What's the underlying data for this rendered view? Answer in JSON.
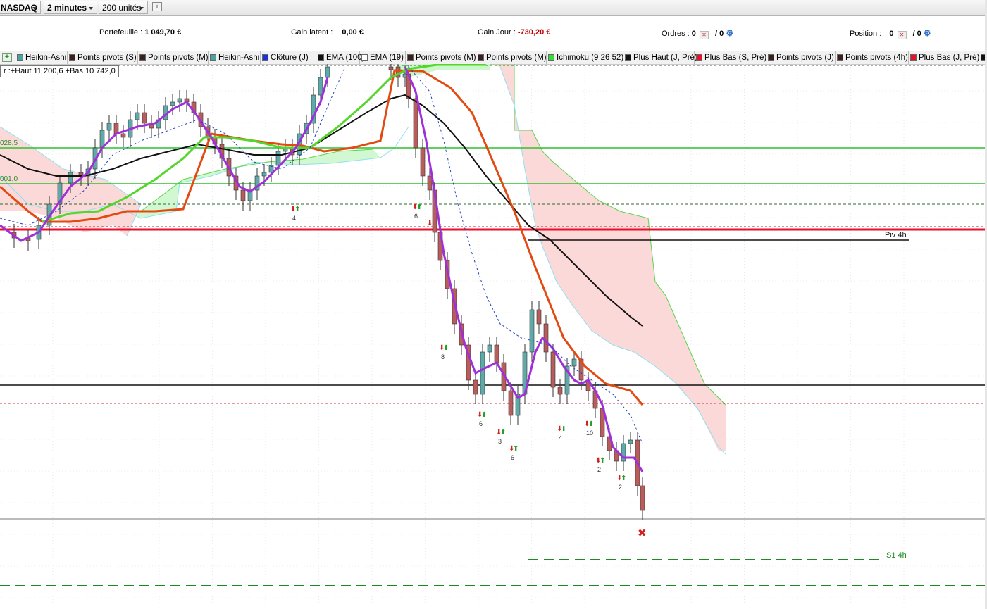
{
  "toolbar": {
    "symbol": "NASDAQ",
    "period": "2 minutes",
    "units": "200 unités"
  },
  "summary": {
    "portefeuille_label": "Portefeuille :",
    "portefeuille_value": "1 049,70 €",
    "gain_latent_label": "Gain latent :",
    "gain_latent_value": "0,00 €",
    "gain_jour_label": "Gain Jour :",
    "gain_jour_value": "-730,20 €",
    "ordres_label": "Ordres :",
    "ordres_value": "0",
    "ordres_total": "/ 0",
    "position_label": "Position :",
    "position_value": "0",
    "position_total": "/ 0"
  },
  "legend": [
    {
      "label": "Heikin-Ashi",
      "color": "#4aa3a3"
    },
    {
      "label": "Points pivots (S)",
      "color": "#3a1f1f"
    },
    {
      "label": "Points pivots (M)",
      "color": "#3a1f1f"
    },
    {
      "label": "Heikin-Ashi",
      "color": "#4aa3a3"
    },
    {
      "label": "Clôture (J)",
      "color": "#1a2fd6"
    },
    {
      "label": "EMA (100)",
      "color": "#111111"
    },
    {
      "label": "EMA (19)",
      "color": "#ffffff"
    },
    {
      "label": "Points pivots (M)",
      "color": "#3a1f1f"
    },
    {
      "label": "Points pivots (M)",
      "color": "#3a1f1f"
    },
    {
      "label": "Ichimoku (9 26 52)",
      "color": "#33dd33"
    },
    {
      "label": "Plus Haut (J, Pré)",
      "color": "#111111"
    },
    {
      "label": "Plus Bas (S, Pré)",
      "color": "#e8102a"
    },
    {
      "label": "Points pivots (J)",
      "color": "#3a1f1f"
    },
    {
      "label": "Points pivots (4h)",
      "color": "#3a1f1f"
    },
    {
      "label": "Plus Bas (J, Pré)",
      "color": "#e8102a"
    },
    {
      "label": "",
      "color": "#111111"
    }
  ],
  "chart": {
    "info_box": "r :+Haut 11 200,6 +Bas 10 742,0",
    "level_labels": [
      "028,5",
      "001,0"
    ],
    "pivot_labels": [
      "Piv 4h",
      "S1 4h"
    ],
    "signal_counts": [
      "4",
      "6",
      "8",
      "6",
      "3",
      "6",
      "4",
      "10",
      "2",
      "2"
    ],
    "colors": {
      "bull_candle": "#5fa9a9",
      "bear_candle": "#b85c5c",
      "ema19": "#9e2fd9",
      "ema100": "#111111",
      "ema_long": "#e34a12",
      "ichimoku_lagging": "#55d62c",
      "kumo_bull": "#ccf7cc",
      "kumo_bear": "#fcd9d9",
      "kumo_edge_green": "#59d64a",
      "kumo_edge_cyan": "#8fe0f0",
      "support_red": "#e8102a",
      "pivot_line": "#111111",
      "level_green": "#2fbf2f",
      "s1_dash": "#1e8a1e"
    }
  }
}
